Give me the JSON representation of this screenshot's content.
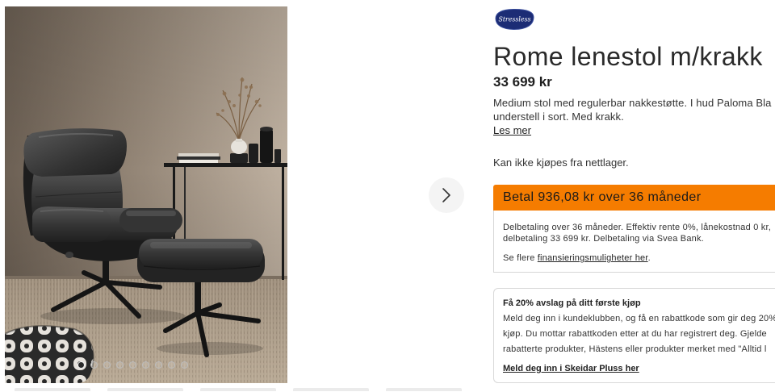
{
  "brand": {
    "logo_text": "Stressless",
    "logo_color": "#1c2c75"
  },
  "product": {
    "title": "Rome lenestol m/krakk",
    "price": "33 699 kr",
    "description_lines": [
      "Medium stol med regulerbar nakkestøtte. I hud Paloma Bla",
      "understell i sort. Med krakk."
    ],
    "read_more": "Les mer",
    "availability": "Kan ikke kjøpes fra nettlager."
  },
  "gallery": {
    "image_count": 9,
    "active_index": 0,
    "next_icon": "chevron-right-icon"
  },
  "financing": {
    "headline": "Betal 936,08 kr over 36 måneder",
    "accent_color": "#f57c00",
    "details_lines": [
      "Delbetaling over 36 måneder. Effektiv rente 0%, lånekostnad 0 kr,",
      "delbetaling 33 699 kr. Delbetaling via Svea Bank."
    ],
    "more_prefix": "Se flere ",
    "more_link": "finansieringsmuligheter her",
    "more_suffix": "."
  },
  "club_offer": {
    "heading": "Få 20% avslag på ditt første kjøp",
    "body_lines": [
      "Meld deg inn i kundeklubben, og få en rabattkode som gir deg 20%",
      "kjøp. Du mottar rabattkoden etter at du har registrert deg. Gjelde",
      "rabatterte produkter, Hästens eller produkter merket med \"Alltid l"
    ],
    "link": "Meld deg inn i Skeidar Pluss her"
  }
}
